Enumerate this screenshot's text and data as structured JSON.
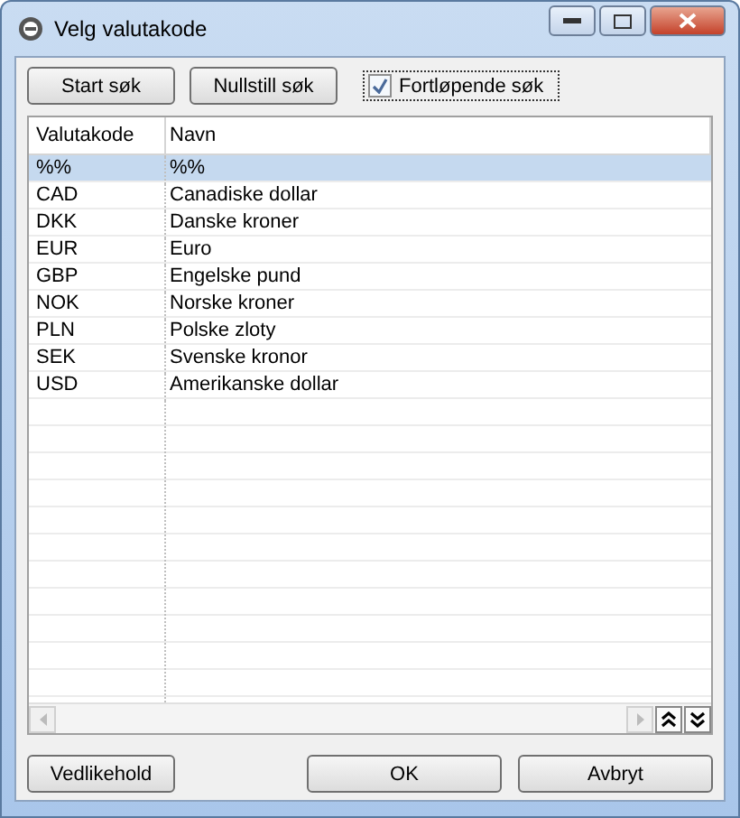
{
  "window": {
    "title": "Velg valutakode"
  },
  "toolbar": {
    "buttons": [
      "Start søk",
      "Nullstill søk"
    ],
    "checkbox": {
      "label": "Fortløpende søk",
      "checked": true
    }
  },
  "table": {
    "columns": [
      "Valutakode",
      "Navn"
    ],
    "rows": [
      {
        "code": "%%",
        "name": "%%",
        "selected": true
      },
      {
        "code": "CAD",
        "name": "Canadiske dollar",
        "selected": false
      },
      {
        "code": "DKK",
        "name": "Danske kroner",
        "selected": false
      },
      {
        "code": "EUR",
        "name": "Euro",
        "selected": false
      },
      {
        "code": "GBP",
        "name": "Engelske pund",
        "selected": false
      },
      {
        "code": "NOK",
        "name": "Norske kroner",
        "selected": false
      },
      {
        "code": "PLN",
        "name": "Polske zloty",
        "selected": false
      },
      {
        "code": "SEK",
        "name": "Svenske kronor",
        "selected": false
      },
      {
        "code": "USD",
        "name": "Amerikanske dollar",
        "selected": false
      }
    ]
  },
  "footer": {
    "left_button": "Vedlikehold",
    "right_buttons": [
      "OK",
      "Avbryt"
    ]
  }
}
